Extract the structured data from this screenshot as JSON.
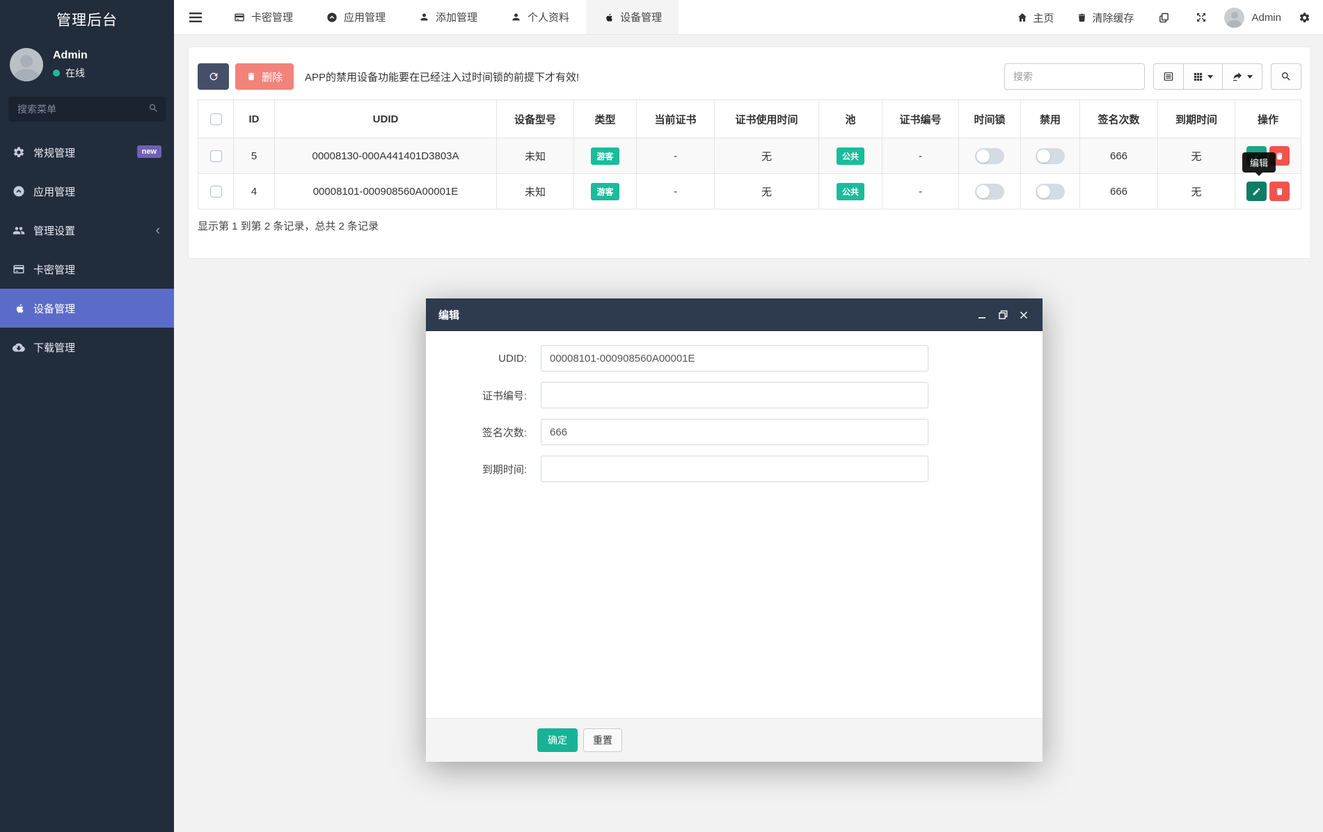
{
  "app_title": "管理后台",
  "sidebar": {
    "user": {
      "name": "Admin",
      "status": "在线"
    },
    "search_placeholder": "搜索菜单",
    "items": [
      {
        "label": "常规管理",
        "badge": "new"
      },
      {
        "label": "应用管理"
      },
      {
        "label": "管理设置"
      },
      {
        "label": "卡密管理"
      },
      {
        "label": "设备管理"
      },
      {
        "label": "下载管理"
      }
    ]
  },
  "navbar": {
    "tabs": [
      {
        "label": "卡密管理"
      },
      {
        "label": "应用管理"
      },
      {
        "label": "添加管理"
      },
      {
        "label": "个人资料"
      },
      {
        "label": "设备管理"
      }
    ],
    "home_label": "主页",
    "clear_cache_label": "清除缓存",
    "user_name": "Admin"
  },
  "toolbar": {
    "delete_label": "删除",
    "notice": "APP的禁用设备功能要在已经注入过时间锁的前提下才有效!",
    "search_placeholder": "搜索"
  },
  "table": {
    "columns": [
      "ID",
      "UDID",
      "设备型号",
      "类型",
      "当前证书",
      "证书使用时间",
      "池",
      "证书编号",
      "时间锁",
      "禁用",
      "签名次数",
      "到期时间",
      "操作"
    ],
    "rows": [
      {
        "id": "5",
        "udid": "00008130-000A441401D3803A",
        "model": "未知",
        "type_badge": "游客",
        "current_cert": "-",
        "cert_time": "无",
        "pool_badge": "公共",
        "cert_no": "-",
        "sign_count": "666",
        "expire": "无"
      },
      {
        "id": "4",
        "udid": "00008101-000908560A00001E",
        "model": "未知",
        "type_badge": "游客",
        "current_cert": "-",
        "cert_time": "无",
        "pool_badge": "公共",
        "cert_no": "-",
        "sign_count": "666",
        "expire": "无"
      }
    ],
    "summary": "显示第 1 到第 2 条记录，总共 2 条记录"
  },
  "tooltip_label": "编辑",
  "modal": {
    "title": "编辑",
    "fields": [
      {
        "label": "UDID:",
        "value": "00008101-000908560A00001E"
      },
      {
        "label": "证书编号:",
        "value": ""
      },
      {
        "label": "签名次数:",
        "value": "666"
      },
      {
        "label": "到期时间:",
        "value": ""
      }
    ],
    "ok_label": "确定",
    "reset_label": "重置"
  },
  "colors": {
    "sidebar_bg": "#222d3c",
    "active_item": "#5b6cc8",
    "badge_new": "#6f61b7",
    "teal_badge": "#1abc9c",
    "edit_green": "#18a689",
    "delete_red": "#f0544c",
    "refresh_navy": "#455068",
    "delete_salmon": "#f2837b",
    "modal_titlebar": "#2e3b4e",
    "ok_green": "#17b394",
    "online_green": "#1dbc9c"
  }
}
